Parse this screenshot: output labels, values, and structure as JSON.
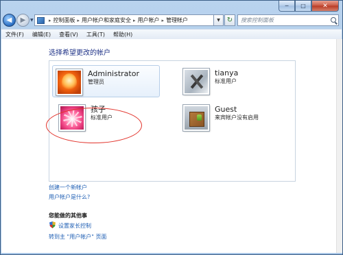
{
  "window": {
    "caption": {
      "minimize": "─",
      "maximize": "□",
      "close": "✕"
    }
  },
  "nav": {
    "back_glyph": "◀",
    "forward_glyph": "▶",
    "dropdown_glyph": "▼"
  },
  "address": {
    "breadcrumbs": [
      "控制面板",
      "用户帐户和家庭安全",
      "用户帐户",
      "管理帐户"
    ],
    "separator": "▸",
    "dropdown_glyph": "▼",
    "refresh_glyph": "↻"
  },
  "search": {
    "placeholder": "搜索控制面板"
  },
  "menu": {
    "items": [
      "文件(F)",
      "编辑(E)",
      "查看(V)",
      "工具(T)",
      "帮助(H)"
    ]
  },
  "main": {
    "heading": "选择希望更改的帐户",
    "accounts": [
      {
        "name": "Administrator",
        "role": "管理员",
        "picture": "orange-flower-picture"
      },
      {
        "name": "tianya",
        "role": "标准用户",
        "picture": "tools-picture"
      },
      {
        "name": "孩子",
        "role": "标准用户",
        "picture": "pink-flower-picture"
      },
      {
        "name": "Guest",
        "role": "来宾帐户没有启用",
        "picture": "briefcase-picture"
      }
    ],
    "links": {
      "create_account": "创建一个新帐户",
      "what_is_account": "用户帐户是什么?"
    },
    "other_section": {
      "title": "您能做的其他事",
      "parental_controls": "设置家长控制",
      "goto_user_accounts": "转到主 \"用户帐户\" 页面"
    }
  },
  "colors": {
    "link": "#1f5fb4",
    "heading": "#1e3287",
    "highlight_ellipse": "#e2322a"
  }
}
